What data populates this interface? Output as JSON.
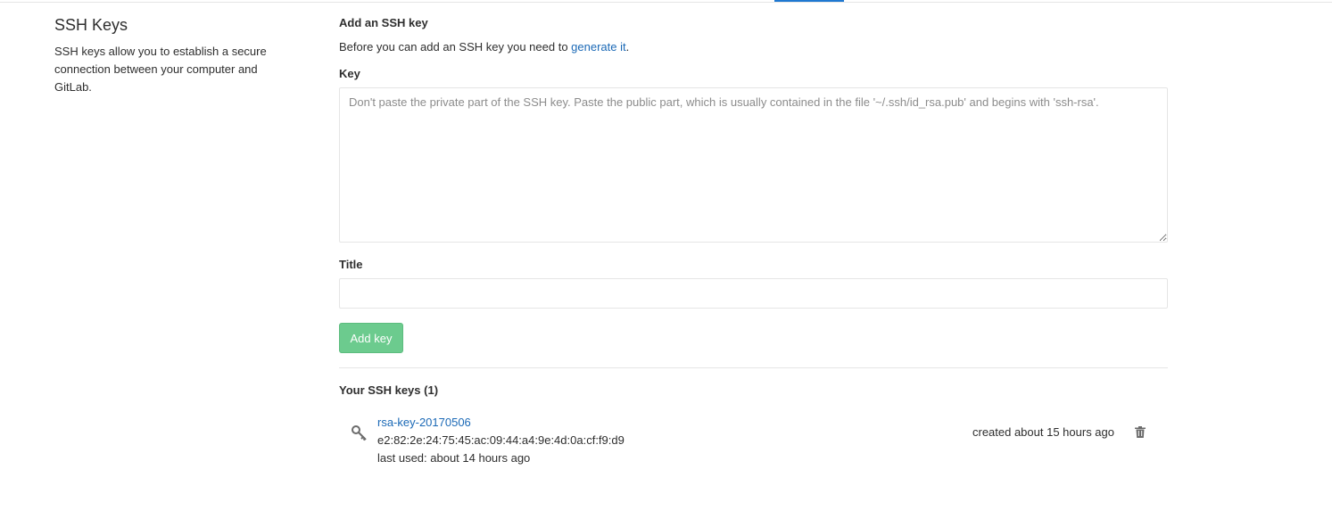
{
  "section": {
    "title": "SSH Keys",
    "description": "SSH keys allow you to establish a secure connection between your computer and GitLab."
  },
  "form": {
    "heading": "Add an SSH key",
    "intro_text": "Before you can add an SSH key you need to ",
    "intro_link": "generate it",
    "intro_suffix": ".",
    "key_label": "Key",
    "key_placeholder": "Don't paste the private part of the SSH key. Paste the public part, which is usually contained in the file '~/.ssh/id_rsa.pub' and begins with 'ssh-rsa'.",
    "title_label": "Title",
    "title_value": "",
    "submit_label": "Add key"
  },
  "keys_list": {
    "heading": "Your SSH keys (1)",
    "items": [
      {
        "name": "rsa-key-20170506",
        "fingerprint": "e2:82:2e:24:75:45:ac:09:44:a4:9e:4d:0a:cf:f9:d9",
        "last_used": "last used: about 14 hours ago",
        "created": "created about 15 hours ago",
        "icon": "key-icon",
        "delete_icon": "trash-icon"
      }
    ]
  },
  "colors": {
    "link": "#1b69b6",
    "button_green": "#6ccb8e",
    "active_tab": "#1f78d1",
    "border": "#e5e5e5"
  }
}
